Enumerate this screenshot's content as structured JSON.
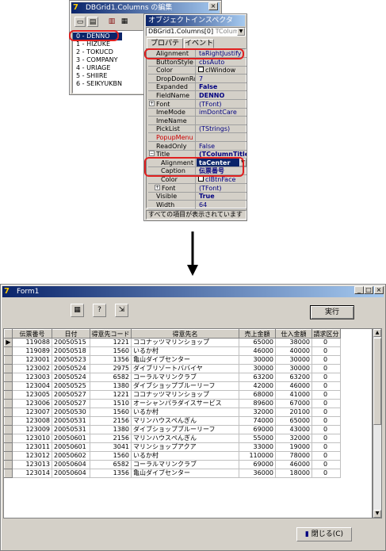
{
  "columns_editor": {
    "title": "DBGrid1.Columns の編集",
    "items": [
      "0 - DENNO",
      "1 - HIZUKE",
      "2 - TOKUCD",
      "3 - COMPANY",
      "4 - URIAGE",
      "5 - SHIIRE",
      "6 - SEIKYUKBN"
    ]
  },
  "inspector": {
    "title": "オブジェクトインスペクタ",
    "selector": "DBGrid1.Columns[0]",
    "selector_type": "TColumn",
    "tabs": [
      "プロパティ",
      "イベント"
    ],
    "rows": [
      {
        "name": "Alignment",
        "value": "taRightJustify"
      },
      {
        "name": "ButtonStyle",
        "value": "cbsAuto"
      },
      {
        "name": "Color",
        "value": "clWindow"
      },
      {
        "name": "DropDownRows",
        "value": "7"
      },
      {
        "name": "Expanded",
        "value": "False"
      },
      {
        "name": "FieldName",
        "value": "DENNO"
      },
      {
        "name": "Font",
        "value": "(TFont)"
      },
      {
        "name": "ImeMode",
        "value": "imDontCare"
      },
      {
        "name": "ImeName",
        "value": ""
      },
      {
        "name": "PickList",
        "value": "(TStrings)"
      },
      {
        "name": "PopupMenu",
        "value": ""
      },
      {
        "name": "ReadOnly",
        "value": "False"
      },
      {
        "name": "Title",
        "value": "(TColumnTitle)"
      },
      {
        "name": "Alignment",
        "value": "taCenter"
      },
      {
        "name": "Caption",
        "value": "伝票番号"
      },
      {
        "name": "Color",
        "value": "clBtnFace"
      },
      {
        "name": "Font",
        "value": "(TFont)"
      },
      {
        "name": "Visible",
        "value": "True"
      },
      {
        "name": "Width",
        "value": "64"
      }
    ],
    "status": "すべての項目が表示されています"
  },
  "form": {
    "title": "Form1",
    "run_button": "実行",
    "close_button": "閉じる(C)",
    "headers": [
      "伝票番号",
      "日付",
      "得意先コード",
      "得意先名",
      "売上金額",
      "仕入金額",
      "請求区分"
    ],
    "rows": [
      [
        "119088",
        "20050515",
        "1221",
        "ココナッツマリンショップ",
        "65000",
        "38000",
        "0"
      ],
      [
        "119089",
        "20050518",
        "1560",
        "いるか村",
        "46000",
        "40000",
        "0"
      ],
      [
        "123001",
        "20050523",
        "1356",
        "亀山ダイブセンター",
        "30000",
        "30000",
        "0"
      ],
      [
        "123002",
        "20050524",
        "2975",
        "ダイブリゾートババイヤ",
        "30000",
        "30000",
        "0"
      ],
      [
        "123003",
        "20050524",
        "6582",
        "コーラルマリンクラブ",
        "63200",
        "63200",
        "0"
      ],
      [
        "123004",
        "20050525",
        "1380",
        "ダイブショップブルーリーフ",
        "42000",
        "46000",
        "0"
      ],
      [
        "123005",
        "20050527",
        "1221",
        "ココナッツマリンショップ",
        "68000",
        "41000",
        "0"
      ],
      [
        "123006",
        "20050527",
        "1510",
        "オーシャンパラダイスサービス",
        "89600",
        "67000",
        "0"
      ],
      [
        "123007",
        "20050530",
        "1560",
        "いるか村",
        "32000",
        "20100",
        "0"
      ],
      [
        "123008",
        "20050531",
        "2156",
        "マリンハウスぺんぎん",
        "74000",
        "65000",
        "0"
      ],
      [
        "123009",
        "20050531",
        "1380",
        "ダイブショップブルーリーフ",
        "69000",
        "43000",
        "0"
      ],
      [
        "123010",
        "20050601",
        "2156",
        "マリンハウスぺんぎん",
        "55000",
        "32000",
        "0"
      ],
      [
        "123011",
        "20050601",
        "3041",
        "マリンショップアクア",
        "33000",
        "19000",
        "0"
      ],
      [
        "123012",
        "20050602",
        "1560",
        "いるか村",
        "110000",
        "78000",
        "0"
      ],
      [
        "123013",
        "20050604",
        "6582",
        "コーラルマリンクラブ",
        "69000",
        "46000",
        "0"
      ],
      [
        "123014",
        "20050604",
        "1356",
        "亀山ダイブセンター",
        "36000",
        "18000",
        "0"
      ]
    ]
  }
}
